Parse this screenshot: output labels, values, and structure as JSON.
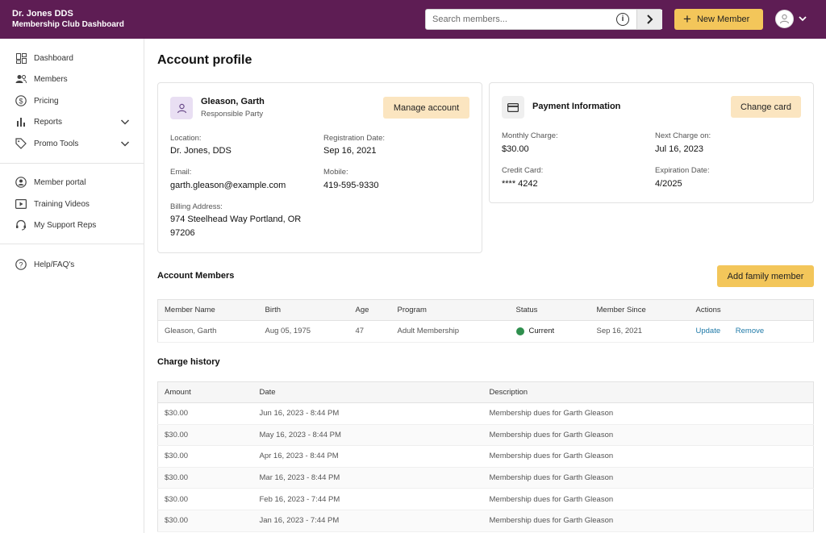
{
  "header": {
    "practice_name": "Dr. Jones DDS",
    "dashboard_title": "Membership Club Dashboard",
    "search_placeholder": "Search members...",
    "new_member_label": "New Member"
  },
  "sidebar": {
    "items": [
      {
        "label": "Dashboard",
        "icon": "dashboard-icon"
      },
      {
        "label": "Members",
        "icon": "members-icon"
      },
      {
        "label": "Pricing",
        "icon": "pricing-icon"
      },
      {
        "label": "Reports",
        "icon": "reports-icon",
        "expandable": true
      },
      {
        "label": "Promo Tools",
        "icon": "tag-icon",
        "expandable": true
      }
    ],
    "secondary": [
      {
        "label": "Member portal",
        "icon": "portal-icon"
      },
      {
        "label": "Training Videos",
        "icon": "video-icon"
      },
      {
        "label": "My Support Reps",
        "icon": "headset-icon"
      }
    ],
    "help": {
      "label": "Help/FAQ's",
      "icon": "help-icon"
    }
  },
  "page": {
    "title": "Account profile"
  },
  "account": {
    "name": "Gleason, Garth",
    "role": "Responsible Party",
    "manage_label": "Manage account",
    "location_label": "Location:",
    "location": "Dr. Jones, DDS",
    "registration_label": "Registration Date:",
    "registration": "Sep 16, 2021",
    "email_label": "Email:",
    "email": "garth.gleason@example.com",
    "mobile_label": "Mobile:",
    "mobile": "419-595-9330",
    "billing_label": "Billing Address:",
    "billing_line1": "974 Steelhead Way Portland, OR",
    "billing_line2": "97206"
  },
  "payment": {
    "title": "Payment Information",
    "change_label": "Change card",
    "monthly_label": "Monthly Charge:",
    "monthly": "$30.00",
    "next_label": "Next Charge on:",
    "next": "Jul 16, 2023",
    "card_label": "Credit Card:",
    "card": "**** 4242",
    "exp_label": "Expiration Date:",
    "exp": "4/2025"
  },
  "members": {
    "title": "Account Members",
    "add_label": "Add family member",
    "columns": [
      "Member Name",
      "Birth",
      "Age",
      "Program",
      "Status",
      "Member Since",
      "Actions"
    ],
    "rows": [
      {
        "name": "Gleason, Garth",
        "birth": "Aug 05, 1975",
        "age": "47",
        "program": "Adult Membership",
        "status": "Current",
        "since": "Sep 16, 2021",
        "update": "Update",
        "remove": "Remove"
      }
    ]
  },
  "charges": {
    "title": "Charge history",
    "columns": [
      "Amount",
      "Date",
      "Description"
    ],
    "rows": [
      {
        "amount": "$30.00",
        "date": "Jun 16, 2023 - 8:44 PM",
        "description": "Membership dues for Garth Gleason"
      },
      {
        "amount": "$30.00",
        "date": "May 16, 2023 - 8:44 PM",
        "description": "Membership dues for Garth Gleason"
      },
      {
        "amount": "$30.00",
        "date": "Apr 16, 2023 - 8:44 PM",
        "description": "Membership dues for Garth Gleason"
      },
      {
        "amount": "$30.00",
        "date": "Mar 16, 2023 - 8:44 PM",
        "description": "Membership dues for Garth Gleason"
      },
      {
        "amount": "$30.00",
        "date": "Feb 16, 2023 - 7:44 PM",
        "description": "Membership dues for Garth Gleason"
      },
      {
        "amount": "$30.00",
        "date": "Jan 16, 2023 - 7:44 PM",
        "description": "Membership dues for Garth Gleason"
      }
    ]
  },
  "colors": {
    "header_bg": "#5e1d54",
    "accent_yellow": "#f3c65a",
    "status_green": "#2f8f4e",
    "link_blue": "#1f7aa8"
  }
}
